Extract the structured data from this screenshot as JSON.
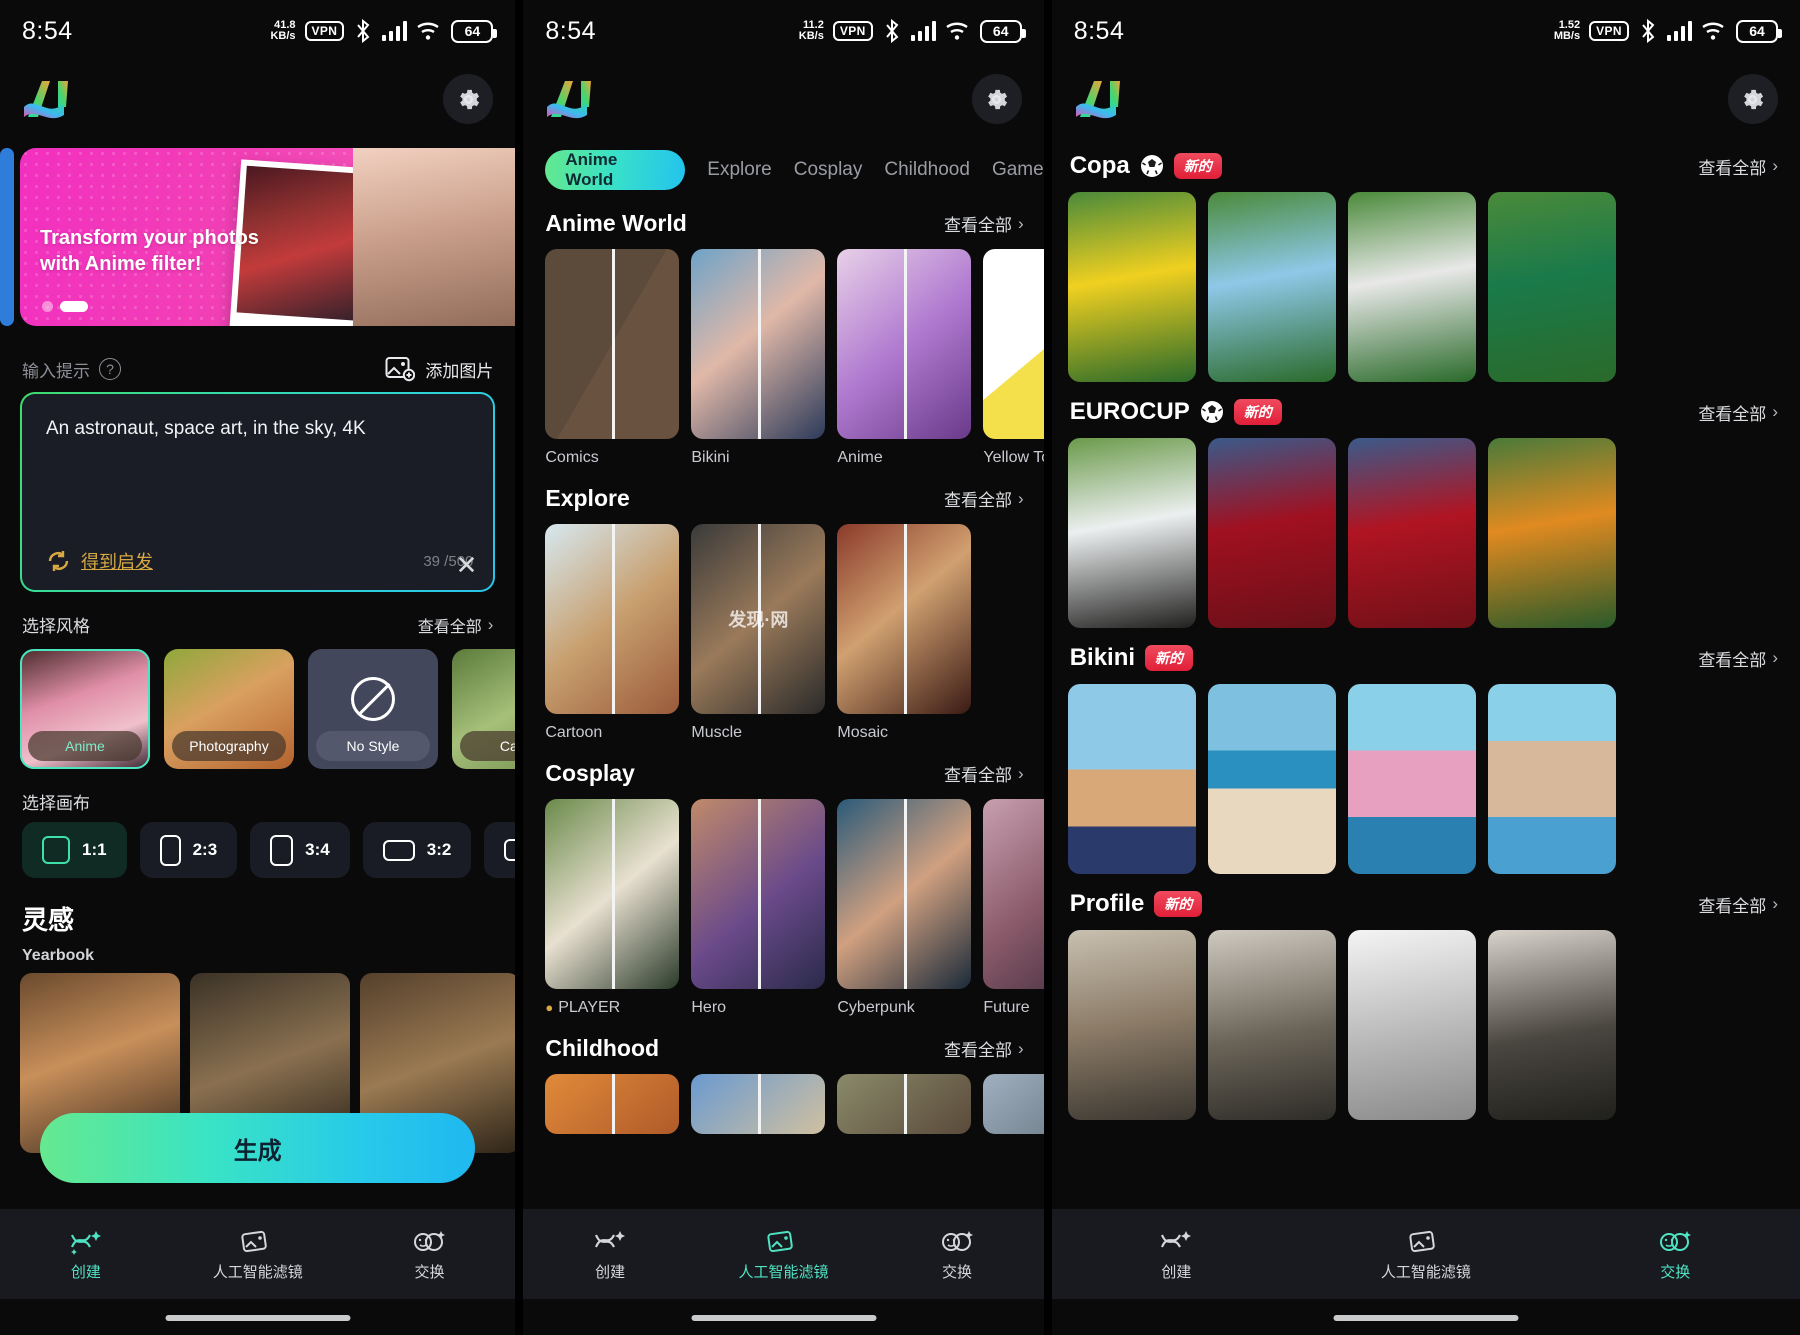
{
  "status_bar": {
    "time": "8:54",
    "net_speeds": [
      "41.8\nKB/s",
      "11.2\nKB/s",
      "1.52\nMB/s"
    ],
    "net1_value": "41.8",
    "net1_unit": "KB/s",
    "net2_value": "11.2",
    "net2_unit": "KB/s",
    "net3_value": "1.52",
    "net3_unit": "MB/s",
    "vpn": "VPN",
    "battery": "64"
  },
  "panel1": {
    "banner": {
      "line1": "Transform your photos",
      "line2": "with Anime filter!"
    },
    "prompt_label": "输入提示",
    "help_icon": "?",
    "add_image_label": "添加图片",
    "prompt_value": "An astronaut, space art, in the sky, 4K",
    "inspire_label": "得到启发",
    "char_count": "39 /500",
    "close_icon": "✕",
    "style_section": {
      "title": "选择风格",
      "see_all": "查看全部"
    },
    "styles": [
      {
        "label": "Anime",
        "selected": true
      },
      {
        "label": "Photography",
        "selected": false
      },
      {
        "label": "No Style",
        "selected": false
      },
      {
        "label": "Carto",
        "selected": false
      }
    ],
    "canvas_section": {
      "title": "选择画布"
    },
    "ratios": [
      {
        "label": "1:1",
        "selected": true
      },
      {
        "label": "2:3",
        "selected": false
      },
      {
        "label": "3:4",
        "selected": false
      },
      {
        "label": "3:2",
        "selected": false
      }
    ],
    "inspiration": {
      "title": "灵感",
      "subtitle": "Yearbook"
    },
    "generate_label": "生成"
  },
  "panel2": {
    "tabs": [
      {
        "label": "Anime World",
        "active": true
      },
      {
        "label": "Explore",
        "active": false
      },
      {
        "label": "Cosplay",
        "active": false
      },
      {
        "label": "Childhood",
        "active": false
      },
      {
        "label": "Game",
        "active": false
      }
    ],
    "see_all": "查看全部",
    "sections": [
      {
        "title": "Anime World",
        "items": [
          {
            "name": "Comics"
          },
          {
            "name": "Bikini"
          },
          {
            "name": "Anime"
          },
          {
            "name": "Yellow Toon"
          }
        ]
      },
      {
        "title": "Explore",
        "watermark": "发现·网",
        "items": [
          {
            "name": "Cartoon"
          },
          {
            "name": "Muscle"
          },
          {
            "name": "Mosaic"
          }
        ]
      },
      {
        "title": "Cosplay",
        "items": [
          {
            "name": "PLAYER",
            "dot": true
          },
          {
            "name": "Hero"
          },
          {
            "name": "Cyberpunk"
          },
          {
            "name": "Future"
          }
        ]
      },
      {
        "title": "Childhood",
        "items": []
      }
    ]
  },
  "panel3": {
    "see_all": "查看全部",
    "badge": "新的",
    "sections": [
      {
        "title": "Copa",
        "icon": "soccer-ball",
        "badge": "新的"
      },
      {
        "title": "EUROCUP",
        "icon": "soccer-ball",
        "badge": "新的"
      },
      {
        "title": "Bikini",
        "badge": "新的"
      },
      {
        "title": "Profile",
        "badge": "新的"
      }
    ]
  },
  "bottom_nav": {
    "items": [
      {
        "label": "创建",
        "icon": "create-icon",
        "active": true
      },
      {
        "label": "人工智能滤镜",
        "icon": "filter-icon",
        "active": false
      },
      {
        "label": "交换",
        "icon": "swap-icon",
        "active": false
      }
    ],
    "mid_active_index": 1,
    "right_active_index": 2
  }
}
